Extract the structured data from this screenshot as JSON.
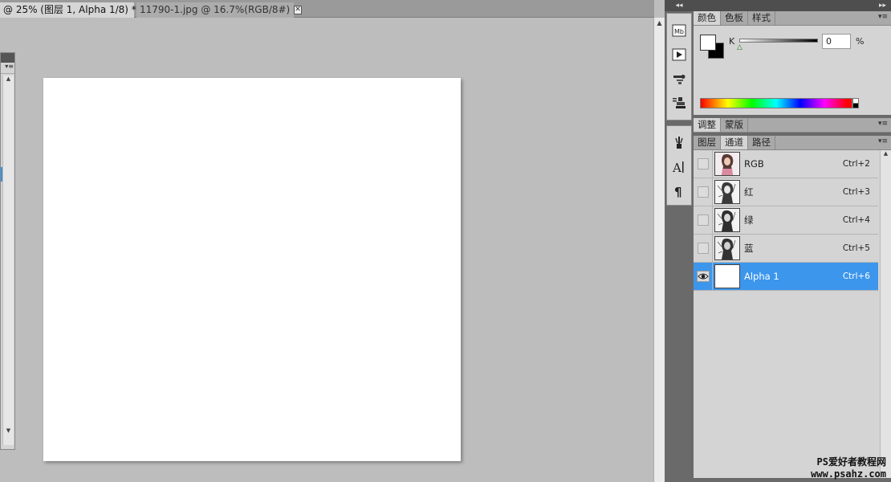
{
  "document_tabs": [
    {
      "label": "@ 25% (图层 1, Alpha 1/8) *",
      "close": "✕"
    },
    {
      "label": "11790-1.jpg @ 16.7%(RGB/8#)",
      "close": "✕"
    }
  ],
  "dock": {
    "collapse": "◂◂",
    "tools": [
      {
        "icon": "mini-bridge-icon",
        "glyph": "Mb"
      },
      {
        "icon": "play-actions-icon",
        "glyph": "▶"
      },
      {
        "icon": "tool-presets-icon",
        "glyph": "⚙"
      },
      {
        "icon": "clone-source-icon",
        "glyph": "⛃"
      },
      {
        "icon": "brush-presets-icon",
        "glyph": "✎"
      },
      {
        "icon": "character-icon",
        "glyph": "A|"
      },
      {
        "icon": "paragraph-icon",
        "glyph": "¶"
      }
    ]
  },
  "right_panel": {
    "collapse": "▸▸",
    "color_panel": {
      "tabs": [
        "颜色",
        "色板",
        "样式"
      ],
      "active_tab": 0,
      "menu": "▾≡",
      "slider_label": "K",
      "slider_value": "0",
      "unit": "%",
      "foreground": "#ffffff",
      "background": "#000000"
    },
    "adjust_panel": {
      "tabs": [
        "调整",
        "蒙版"
      ],
      "active_tab": 0,
      "menu": "▾≡"
    },
    "channels_panel": {
      "tabs": [
        "图层",
        "通道",
        "路径"
      ],
      "active_tab": 1,
      "menu": "▾≡",
      "rows": [
        {
          "name": "RGB",
          "shortcut": "Ctrl+2",
          "visible": false,
          "selected": false
        },
        {
          "name": "红",
          "shortcut": "Ctrl+3",
          "visible": false,
          "selected": false
        },
        {
          "name": "绿",
          "shortcut": "Ctrl+4",
          "visible": false,
          "selected": false
        },
        {
          "name": "蓝",
          "shortcut": "Ctrl+5",
          "visible": false,
          "selected": false
        },
        {
          "name": "Alpha 1",
          "shortcut": "Ctrl+6",
          "visible": true,
          "selected": true
        }
      ]
    }
  },
  "watermark": {
    "line1": "PS爱好者教程网",
    "line2": "www.psahz.com"
  },
  "colors": {
    "selection": "#3c96ec",
    "panel_bg": "#d4d4d4",
    "workspace_bg": "#bdbdbd"
  }
}
